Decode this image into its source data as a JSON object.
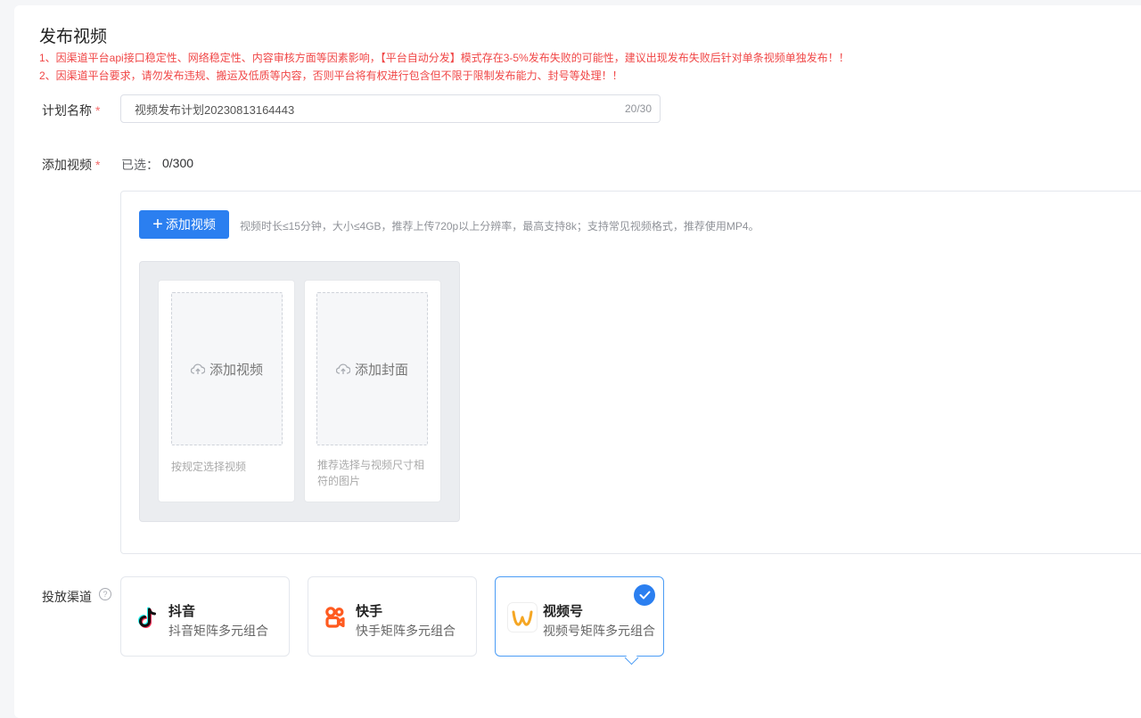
{
  "page": {
    "title": "发布视频",
    "notices": [
      "1、因渠道平台api接口稳定性、网络稳定性、内容审核方面等因素影响，【平台自动分发】模式存在3-5%发布失败的可能性，建议出现发布失败后针对单条视频单独发布！！",
      "2、因渠道平台要求，请勿发布违规、搬运及低质等内容，否则平台将有权进行包含但不限于限制发布能力、封号等处理！！"
    ]
  },
  "form": {
    "plan_name": {
      "label": "计划名称",
      "required_mark": "*",
      "value": "视频发布计划20230813164443",
      "counter": "20/30"
    },
    "add_video": {
      "label": "添加视频",
      "required_mark": "*",
      "selected_prefix": "已选：",
      "selected_count": "0/300",
      "button_label": "添加视频",
      "tip": "视频时长≤15分钟，大小≤4GB，推荐上传720p以上分辨率，最高支持8k；支持常见视频格式，推荐使用MP4。",
      "video_slot": {
        "label": "添加视频",
        "hint": "按规定选择视频"
      },
      "cover_slot": {
        "label": "添加封面",
        "hint": "推荐选择与视频尺寸相符的图片"
      }
    },
    "channels": {
      "label": "投放渠道",
      "help_glyph": "?",
      "items": [
        {
          "name": "抖音",
          "desc": "抖音矩阵多元组合",
          "icon": "douyin-icon",
          "selected": false
        },
        {
          "name": "快手",
          "desc": "快手矩阵多元组合",
          "icon": "kuaishou-icon",
          "selected": false
        },
        {
          "name": "视频号",
          "desc": "视频号矩阵多元组合",
          "icon": "shipinhao-icon",
          "selected": true
        }
      ]
    }
  },
  "colors": {
    "primary": "#2b7ff0",
    "warning_text": "#f04646",
    "required": "#f56c6c",
    "kuaishou": "#ff5a1f",
    "shipinhao": "#f5a623"
  }
}
